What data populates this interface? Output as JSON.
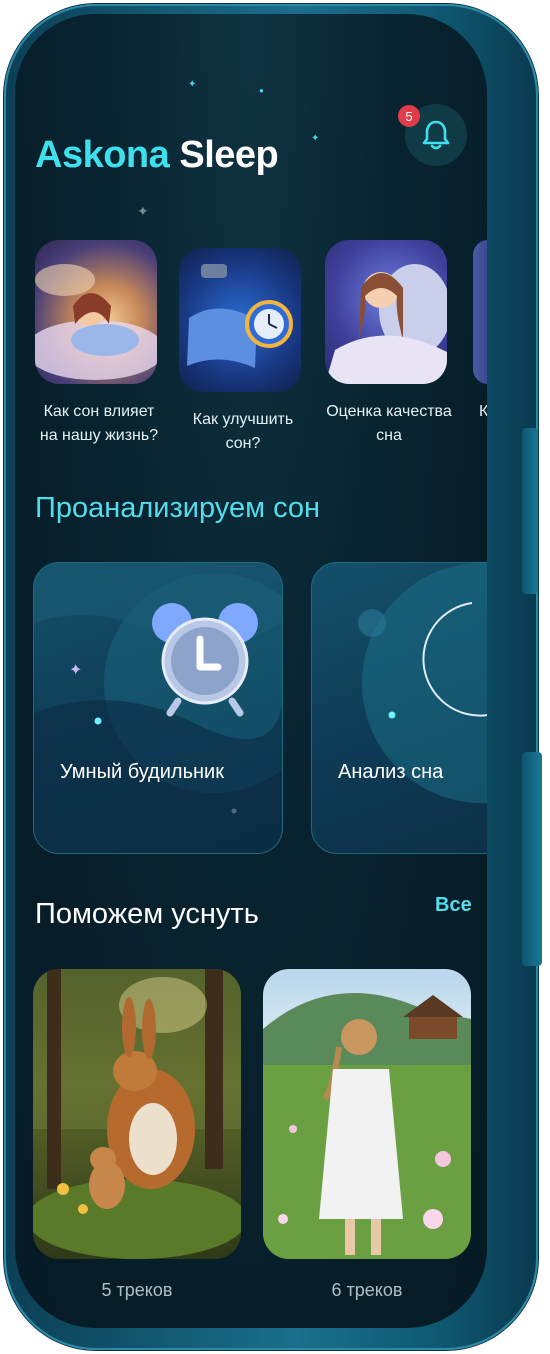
{
  "app": {
    "brand_part1": "Askona",
    "brand_part2": "Sleep"
  },
  "header": {
    "notifications_count": "5",
    "bell_icon": "bell-icon"
  },
  "stories": [
    {
      "caption": "Как сон влияет на нашу жизнь?"
    },
    {
      "caption": "Как улучшить сон?"
    },
    {
      "caption": "Оценка качества сна"
    },
    {
      "caption": "К"
    }
  ],
  "analyze": {
    "title": "Проанализируем сон",
    "cards": [
      {
        "label": "Умный будильник",
        "icon": "alarm-clock-icon"
      },
      {
        "label": "Анализ сна",
        "icon": "moon-icon"
      }
    ]
  },
  "help_sleep": {
    "title": "Поможем уснуть",
    "see_all": "Все",
    "tracks": [
      {
        "count": "5 треков"
      },
      {
        "count": "6 треков"
      }
    ]
  },
  "colors": {
    "accent": "#3fe0ee",
    "background": "#061a24",
    "badge": "#e23b4a",
    "frame": "#1a6f8c"
  }
}
